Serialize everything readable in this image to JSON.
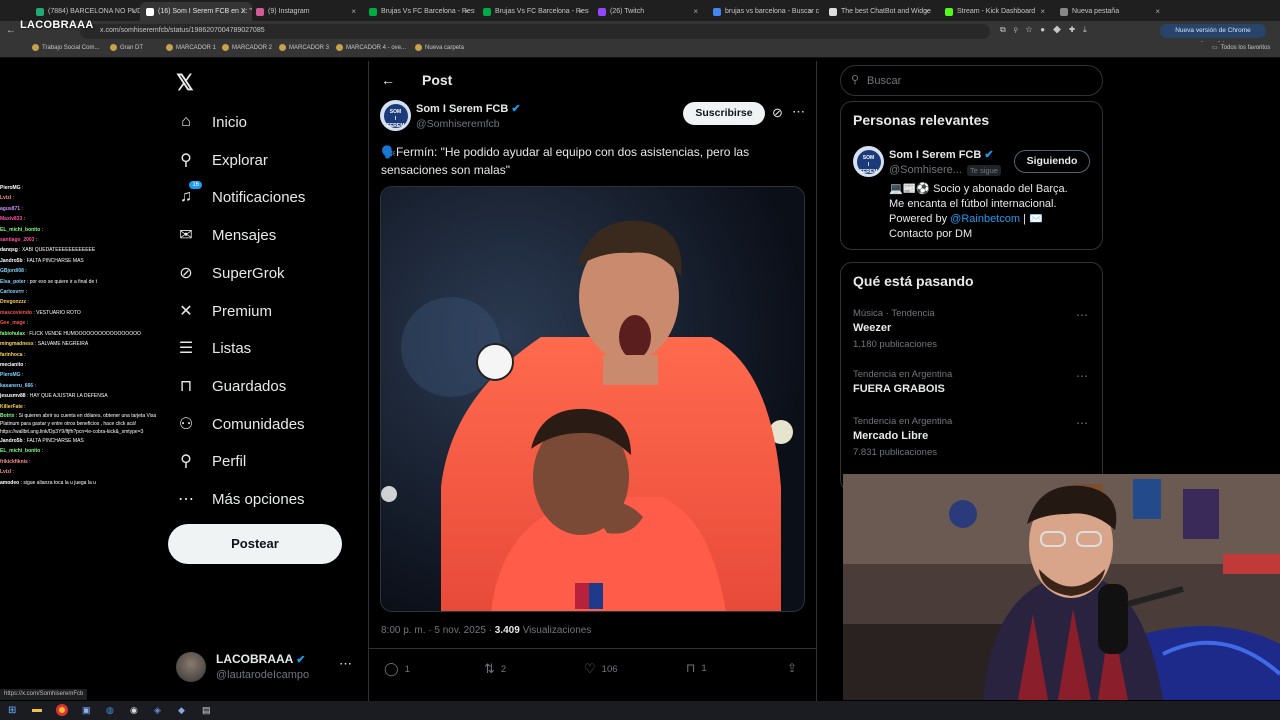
{
  "browser": {
    "tabs": [
      {
        "title": "(7884) BARCELONA NO PUDO",
        "active": false
      },
      {
        "title": "(16) Som I Serem FCB en X: \"",
        "active": true
      },
      {
        "title": "(9) Instagram",
        "active": false
      },
      {
        "title": "Brujas Vs FC Barcelona - Resu",
        "active": false
      },
      {
        "title": "Brujas Vs FC Barcelona - Resu",
        "active": false
      },
      {
        "title": "(26) Twitch",
        "active": false
      },
      {
        "title": "brujas vs barcelona - Buscar c",
        "active": false
      },
      {
        "title": "The best ChatBot and Widge",
        "active": false
      },
      {
        "title": "Stream - Kick Dashboard",
        "active": false
      },
      {
        "title": "Nueva pestaña",
        "active": false
      }
    ],
    "url": "x.com/somhiseremfcb/status/1986207004789027085",
    "update_label": "Nueva versión de Chrome disponible",
    "bookmarks": [
      "Trabajo Social Com...",
      "Gran DT",
      "MARCADOR 1",
      "MARCADOR 2",
      "MARCADOR 3",
      "MARCADOR 4 - ove...",
      "Nueva carpeta"
    ],
    "all_bookmarks": "Todos los favoritos",
    "hover_url": "https://x.com/SomhiseremFcb"
  },
  "stream_logo": "LACOBRAAA",
  "chat": [
    {
      "user": "PieroMG",
      "msg": "",
      "color": "#ffffff"
    },
    {
      "user": "Lvizl",
      "msg": "",
      "color": "#ff8c8c"
    },
    {
      "user": "agus871",
      "msg": "",
      "color": "#c792ff"
    },
    {
      "user": "Maxiv833",
      "msg": "",
      "color": "#ff4fa3"
    },
    {
      "user": "EL_michi_bonito",
      "msg": "",
      "color": "#7fff7f"
    },
    {
      "user": "santiago_2003",
      "msg": "",
      "color": "#ff4fa3"
    },
    {
      "user": "danqsg",
      "msg": "XABI QUEDATEEEEEEEEEEEE",
      "color": "#ffffff"
    },
    {
      "user": "Jandro5b",
      "msg": "FALTA PINCHARSE MAS",
      "color": "#ffffff"
    },
    {
      "user": "GBjordi08",
      "msg": "",
      "color": "#7fd3ff"
    },
    {
      "user": "Elsa_poter",
      "msg": "por eso se quiere ir a final de t",
      "color": "#7fd3ff"
    },
    {
      "user": "Carlosvrrr",
      "msg": "",
      "color": "#7fd3ff"
    },
    {
      "user": "Dnvgonzzz",
      "msg": "",
      "color": "#ffd34f"
    },
    {
      "user": "mascoviendo",
      "msg": "VESTUARIO ROTO",
      "color": "#ff4f4f"
    },
    {
      "user": "Gee_mage",
      "msg": "",
      "color": "#ff4f4f"
    },
    {
      "user": "fabiohulax",
      "msg": "FLICK VENDE HUMOOOOOOOOOOOOOOOOO",
      "color": "#7fff7f"
    },
    {
      "user": "mingmadness",
      "msg": "SALVAME NEGREIRA",
      "color": "#ffd34f"
    },
    {
      "user": "farinhoca",
      "msg": "",
      "color": "#ffd34f"
    },
    {
      "user": "mecianito",
      "msg": "",
      "color": "#ffffff"
    },
    {
      "user": "PieroMG",
      "msg": "",
      "color": "#7fd3ff"
    },
    {
      "user": "kasaneru_666",
      "msg": "",
      "color": "#7fd3ff"
    },
    {
      "user": "jesusmv88",
      "msg": "HAY QUE AJUSTAR LA DEFENSA",
      "color": "#ffffff"
    },
    {
      "user": "KillerFate",
      "msg": "",
      "color": "#ffd34f"
    },
    {
      "user": "Botrix",
      "msg": "Si quieren abrir su cuenta en dólares, obtener una tarjeta Visa Platinum para gastar y entre otros beneficios , hace click acá! https://wallbit.ang.link/Dp3Y9/lfjfh?pcn=le-cobra-kick&_smtype=3",
      "color": "#7fff7f"
    },
    {
      "user": "Jandro5b",
      "msg": "FALTA PINCHARSE MAS",
      "color": "#ffffff"
    },
    {
      "user": "EL_michi_bonito",
      "msg": "",
      "color": "#7fff7f"
    },
    {
      "user": "frikickfiknis",
      "msg": "",
      "color": "#ff8c8c"
    },
    {
      "user": "Lvizl",
      "msg": "",
      "color": "#ff8c8c"
    },
    {
      "user": "amodeo",
      "msg": "sigue alianza toca la u juega la u",
      "color": "#ffffff"
    }
  ],
  "nav": {
    "items": [
      {
        "label": "Inicio",
        "icon": "home-icon",
        "glyph": "⌂"
      },
      {
        "label": "Explorar",
        "icon": "search-icon",
        "glyph": "⚲"
      },
      {
        "label": "Notificaciones",
        "icon": "bell-icon",
        "glyph": "♫",
        "badge": "16"
      },
      {
        "label": "Mensajes",
        "icon": "mail-icon",
        "glyph": "✉"
      },
      {
        "label": "SuperGrok",
        "icon": "grok-icon",
        "glyph": "⊘"
      },
      {
        "label": "Premium",
        "icon": "x-logo-icon",
        "glyph": "✕"
      },
      {
        "label": "Listas",
        "icon": "list-icon",
        "glyph": "☰"
      },
      {
        "label": "Guardados",
        "icon": "bookmark-icon",
        "glyph": "⊓"
      },
      {
        "label": "Comunidades",
        "icon": "communities-icon",
        "glyph": "⚇"
      },
      {
        "label": "Perfil",
        "icon": "profile-icon",
        "glyph": "⚲"
      },
      {
        "label": "Más opciones",
        "icon": "more-icon",
        "glyph": "⋯"
      }
    ],
    "post_label": "Postear"
  },
  "account": {
    "name": "LACOBRAAA",
    "handle": "@lautarodeIcampo"
  },
  "post": {
    "header": "Post",
    "author_name": "Som I Serem FCB",
    "author_handle": "@Somhiseremfcb",
    "subscribe_label": "Suscribirse",
    "text": "🗣️Fermín: \"He podido ayudar al equipo con dos asistencias, pero las sensaciones son malas\"",
    "time": "8:00 p. m. · 5 nov. 2025 · ",
    "views_count": "3.409",
    "views_label": " Visualizaciones",
    "replies": "1",
    "reposts": "2",
    "likes": "106",
    "bookmarks": "1"
  },
  "search": {
    "placeholder": "Buscar"
  },
  "relevant": {
    "title": "Personas relevantes",
    "name": "Som I Serem FCB",
    "handle": "@Somhisere...",
    "follows_you": "Te sigue",
    "follow_label": "Siguiendo",
    "bio_1": "💻📰⚽ Socio y abonado del Barça.",
    "bio_2": "Me encanta el fútbol internacional.",
    "bio_3_a": "Powered by ",
    "bio_3_link": "@Rainbetcom",
    "bio_3_b": " | ✉️",
    "bio_4": "Contacto por DM"
  },
  "trends": {
    "title": "Qué está pasando",
    "items": [
      {
        "context": "Música · Tendencia",
        "name": "Weezer",
        "count": "1.180 publicaciones"
      },
      {
        "context": "Tendencia en Argentina",
        "name": "FUERA GRABOIS",
        "count": ""
      },
      {
        "context": "Tendencia en Argentina",
        "name": "Mercado Libre",
        "count": "7.831 publicaciones"
      }
    ]
  },
  "colors": {
    "accent": "#1d9bf0",
    "bg": "#000000",
    "border": "#2f3336",
    "muted": "#71767b"
  }
}
